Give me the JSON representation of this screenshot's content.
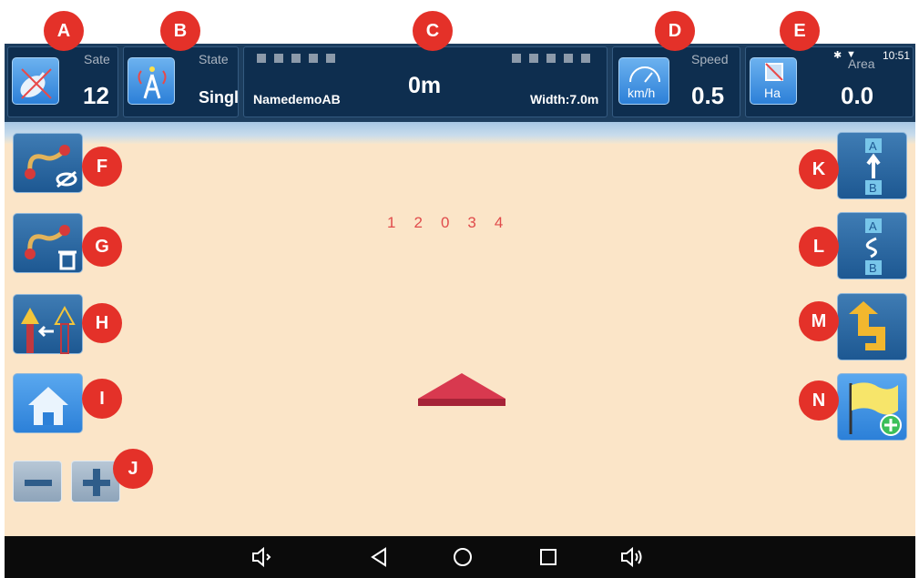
{
  "satellites": {
    "label": "Sate",
    "value": "12"
  },
  "state": {
    "label": "State",
    "value": "Singl"
  },
  "guidance": {
    "name": "NamedemoAB",
    "offset": "0m",
    "width": "Width:7.0m"
  },
  "speed": {
    "label": "Speed",
    "unit": "km/h",
    "value": "0.5"
  },
  "area": {
    "label": "Area",
    "unit": "Ha",
    "value": "0.0"
  },
  "system_status": {
    "time": "10:51"
  },
  "field_numbers": [
    "1",
    "2",
    "0",
    "3",
    "4"
  ],
  "callouts": [
    "A",
    "B",
    "C",
    "D",
    "E",
    "F",
    "G",
    "H",
    "I",
    "J",
    "K",
    "L",
    "M",
    "N"
  ],
  "colors": {
    "header": "#1c3d5e",
    "panel": "#0e2e4f",
    "field": "#fbe5c8",
    "button": "#2c80d8",
    "callout": "#e43129",
    "vehicle": "#d8394f"
  },
  "icons": {
    "left_buttons": [
      "hide-track-icon",
      "delete-track-icon",
      "shift-line-icon",
      "home-icon"
    ],
    "right_buttons": [
      "ab-straight-line-icon",
      "ab-curve-line-icon",
      "headland-turn-icon",
      "add-flag-icon"
    ],
    "nav": [
      "volume-down-icon",
      "back-icon",
      "home-circle-icon",
      "recents-icon",
      "volume-up-icon"
    ]
  }
}
